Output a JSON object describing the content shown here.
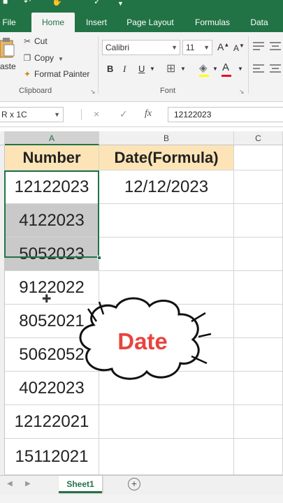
{
  "app": {
    "accent_color": "#217346",
    "title_bar_icons": [
      "save-icon",
      "undo-icon",
      "touch-mode-icon",
      "checkmark-icon",
      "customize-dropdown-icon"
    ]
  },
  "tabs": [
    {
      "label": "File",
      "active": false
    },
    {
      "label": "Home",
      "active": true
    },
    {
      "label": "Insert",
      "active": false
    },
    {
      "label": "Page Layout",
      "active": false
    },
    {
      "label": "Formulas",
      "active": false
    },
    {
      "label": "Data",
      "active": false
    }
  ],
  "clipboard": {
    "paste_label": "aste",
    "cut_label": "Cut",
    "copy_label": "Copy",
    "format_painter_label": "Format Painter",
    "group_label": "Clipboard"
  },
  "font": {
    "font_name": "Calibri",
    "font_size": "11",
    "bold_label": "B",
    "italic_label": "I",
    "underline_label": "U",
    "increase_label": "A",
    "decrease_label": "A",
    "font_color_label": "A",
    "group_label": "Font",
    "font_color": "#e81123",
    "fill_color": "#ffff00"
  },
  "formula_bar": {
    "name_box": "R x 1C",
    "fx_label": "fx",
    "cancel_label": "×",
    "enter_label": "✓",
    "value": "12122023"
  },
  "columns": [
    {
      "label": "A",
      "selected": true
    },
    {
      "label": "B",
      "selected": false
    },
    {
      "label": "C",
      "selected": false
    }
  ],
  "table": {
    "headers": [
      "Number",
      "Date(Formula)"
    ],
    "header_fill": "#fde4b6",
    "rows": [
      [
        "12122023",
        "12/12/2023"
      ],
      [
        "4122023",
        ""
      ],
      [
        "5052023",
        ""
      ],
      [
        "9122022",
        ""
      ],
      [
        "8052021",
        ""
      ],
      [
        "5062052",
        ""
      ],
      [
        "4022023",
        ""
      ],
      [
        "12122021",
        ""
      ],
      [
        "15112021",
        ""
      ]
    ]
  },
  "callout": {
    "text": "Date",
    "color": "#e8433f"
  },
  "sheets": {
    "active": "Sheet1",
    "add_icon": "plus-circle-icon"
  }
}
